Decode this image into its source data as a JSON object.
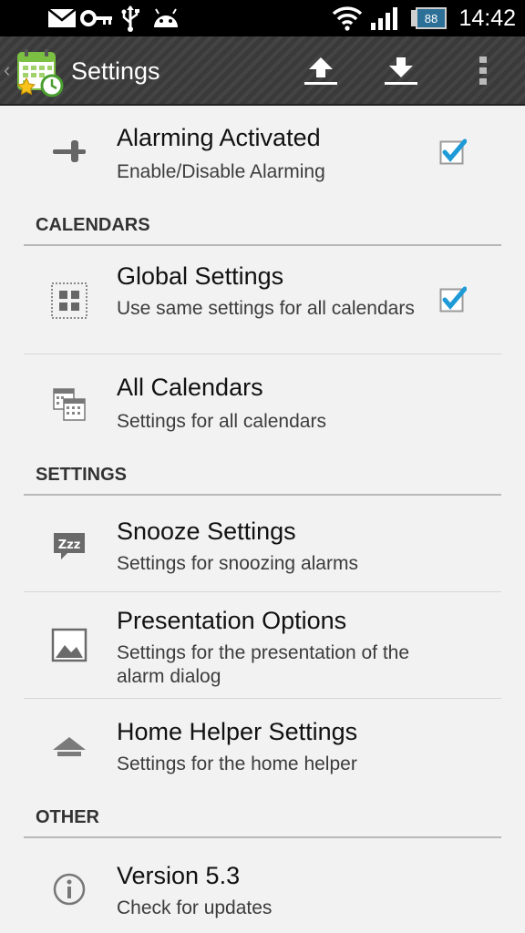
{
  "status_bar": {
    "time": "14:42",
    "battery_level": "88",
    "icons": [
      "mail-icon",
      "key-icon",
      "usb-icon",
      "android-icon",
      "wifi-icon",
      "signal-icon",
      "battery-icon"
    ]
  },
  "action_bar": {
    "title": "Settings",
    "icons": [
      "back-caret-icon",
      "calendar-alarm-app-icon",
      "upload-icon",
      "download-icon",
      "overflow-menu-icon"
    ]
  },
  "items": {
    "alarming": {
      "title": "Alarming Activated",
      "subtitle": "Enable/Disable Alarming",
      "checked": true,
      "icon": "toggle-switch-icon"
    },
    "global": {
      "title": "Global Settings",
      "subtitle": "Use same settings for all calendars",
      "checked": true,
      "icon": "grid-icon"
    },
    "all_calendars": {
      "title": "All Calendars",
      "subtitle": "Settings for all calendars",
      "icon": "calendars-icon"
    },
    "snooze": {
      "title": "Snooze Settings",
      "subtitle": "Settings for snoozing alarms",
      "icon": "zzz-icon"
    },
    "presentation": {
      "title": "Presentation Options",
      "subtitle": "Settings for the presentation of the alarm dialog",
      "icon": "picture-icon"
    },
    "home_helper": {
      "title": "Home Helper Settings",
      "subtitle": "Settings for the home helper",
      "icon": "home-icon"
    },
    "version": {
      "title": "Version 5.3",
      "subtitle": "Check for updates",
      "icon": "info-icon"
    }
  },
  "categories": {
    "calendars": "CALENDARS",
    "settings": "SETTINGS",
    "other": "OTHER"
  },
  "colors": {
    "accent_check": "#1e9bd7",
    "action_bar": "#3a3a3a",
    "background": "#f2f2f2"
  }
}
